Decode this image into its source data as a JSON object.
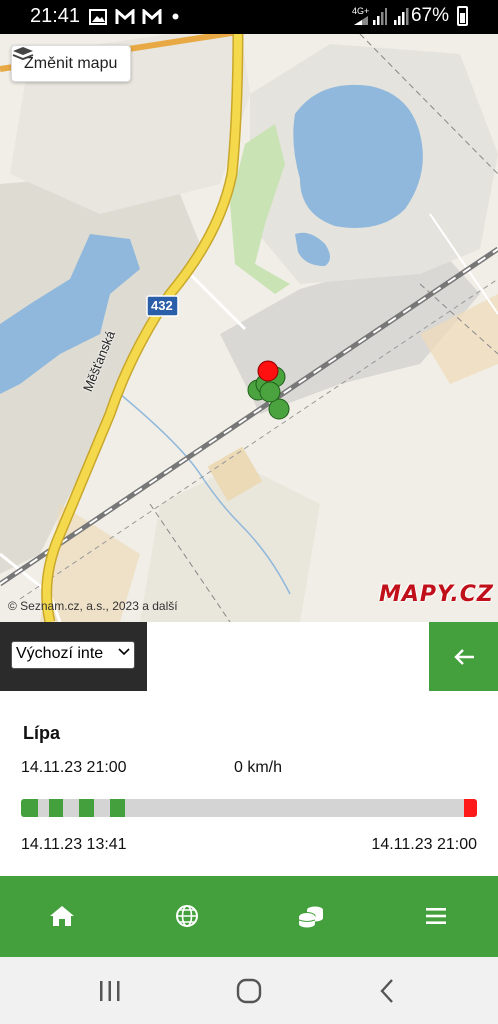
{
  "status_bar": {
    "time": "21:41",
    "network": "4G+",
    "battery": "67%",
    "icons": [
      "image-icon",
      "gmail-icon",
      "gmail-icon",
      "dot-icon",
      "signal-icon",
      "signal-icon",
      "battery-icon"
    ]
  },
  "map": {
    "change_map_label": "Změnit mapu",
    "road_number": "432",
    "street_name": "Měšťanská",
    "copyright": "© Seznam.cz, a.s., 2023 a další",
    "brand": "MAPY.CZ",
    "colors": {
      "water": "#8fb8dc",
      "road": "#f2d64a",
      "building": "#d9d8d5",
      "marker_green": "#4aa33f",
      "marker_red": "#ff1010"
    }
  },
  "controls": {
    "select_value": "Výchozí inte",
    "back_icon": "arrow-left-icon"
  },
  "device": {
    "name": "Lípa",
    "datetime": "14.11.23 21:00",
    "speed": "0 km/h",
    "start_time": "14.11.23 13:41",
    "end_time": "14.11.23 21:00"
  },
  "timeline": {
    "colors": {
      "active": "#43a03c",
      "inactive": "#d4d4d4",
      "current": "#ff1a1a"
    }
  },
  "bottom_nav": {
    "items": [
      "home-icon",
      "globe-icon",
      "coins-icon",
      "menu-icon"
    ]
  },
  "android_nav": {
    "items": [
      "recents-icon",
      "home-circle-icon",
      "back-chevron-icon"
    ]
  }
}
